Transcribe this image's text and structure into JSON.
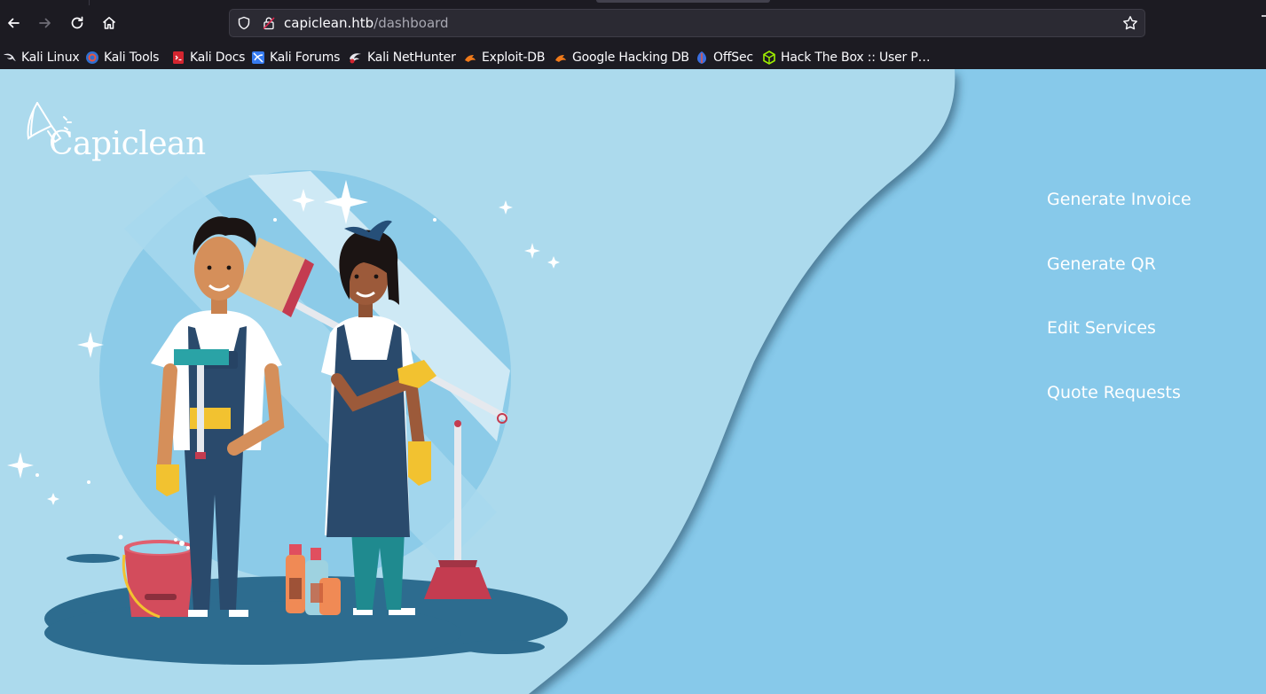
{
  "browser": {
    "url_host": "capiclean.htb",
    "url_path": "/dashboard",
    "bookmarks": [
      {
        "label": "Kali Linux",
        "icon": "kali-dragon-icon"
      },
      {
        "label": "Kali Tools",
        "icon": "kali-tools-icon"
      },
      {
        "label": "Kali Docs",
        "icon": "kali-docs-icon"
      },
      {
        "label": "Kali Forums",
        "icon": "kali-forums-icon"
      },
      {
        "label": "Kali NetHunter",
        "icon": "kali-nethunter-icon"
      },
      {
        "label": "Exploit-DB",
        "icon": "exploit-db-icon"
      },
      {
        "label": "Google Hacking DB",
        "icon": "ghdb-icon"
      },
      {
        "label": "OffSec",
        "icon": "offsec-icon"
      },
      {
        "label": "Hack The Box :: User P…",
        "icon": "htb-cube-icon"
      }
    ]
  },
  "site": {
    "logo": "Capiclean",
    "menu": [
      "Generate Invoice",
      "Generate QR",
      "Edit Services",
      "Quote Requests"
    ]
  },
  "colors": {
    "page_bg": "#87c9ea",
    "left_panel": "#acdaed",
    "menu_text": "#ffffff",
    "browser_bg": "#1c1b22",
    "urlbar_bg": "#2b2a33"
  }
}
